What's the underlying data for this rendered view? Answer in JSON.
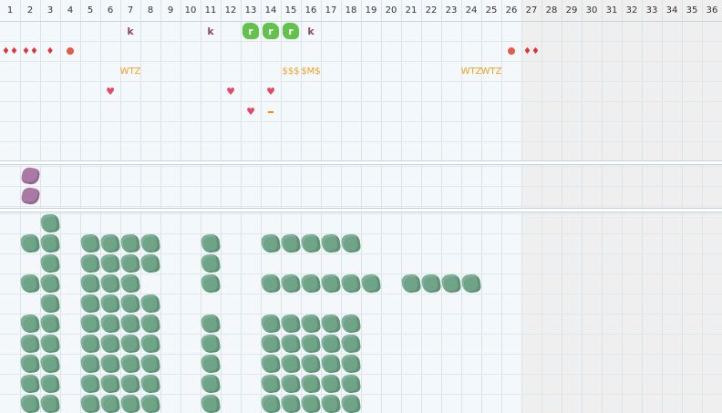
{
  "columns": [
    "1",
    "2",
    "3",
    "4",
    "5",
    "6",
    "7",
    "8",
    "9",
    "10",
    "11",
    "12",
    "13",
    "14",
    "15",
    "16",
    "17",
    "18",
    "19",
    "20",
    "21",
    "22",
    "23",
    "24",
    "25",
    "26",
    "27",
    "28",
    "29",
    "30",
    "31",
    "32",
    "33",
    "34",
    "35",
    "36"
  ],
  "colors": {
    "leaf": "#6fa489",
    "purple": "#a97aa3",
    "badge": "#63c24b",
    "heart": "#e04a66",
    "drop": "#e0333a",
    "orange": "#f0a020",
    "shade": "#efefef"
  },
  "section1": {
    "k_markers": [
      {
        "col": 7,
        "text": "k"
      },
      {
        "col": 11,
        "text": "k"
      },
      {
        "col": 16,
        "text": "k"
      }
    ],
    "badges": [
      {
        "col": 13,
        "text": "r"
      },
      {
        "col": 14,
        "text": "r"
      },
      {
        "col": 15,
        "text": "r"
      }
    ],
    "drops": [
      {
        "col": 1,
        "text": "♦♦"
      },
      {
        "col": 2,
        "text": "♦♦"
      },
      {
        "col": 3,
        "text": "♦"
      },
      {
        "col": 27,
        "text": "♦♦"
      }
    ],
    "dots": [
      4,
      26
    ],
    "labels": [
      {
        "col": 7,
        "text": "WTZ"
      },
      {
        "col": 15,
        "text": "$$$"
      },
      {
        "col": 16,
        "text": "$M$"
      },
      {
        "col": 24,
        "text": "WTZ"
      },
      {
        "col": 25,
        "text": "WTZ"
      }
    ],
    "hearts": [
      {
        "col": 6,
        "row": 3
      },
      {
        "col": 12,
        "row": 3
      },
      {
        "col": 14,
        "row": 3
      },
      {
        "col": 13,
        "row": 4
      }
    ],
    "dash_col": 14
  },
  "section2": {
    "purple_rows": [
      [
        2
      ],
      [
        2
      ]
    ]
  },
  "section3": {
    "leaf_rows": [
      [
        3
      ],
      [
        2,
        3,
        5,
        6,
        7,
        8,
        11,
        14,
        15,
        16,
        17,
        18
      ],
      [
        3,
        5,
        6,
        7,
        8,
        11
      ],
      [
        2,
        3,
        5,
        6,
        7,
        11,
        14,
        15,
        16,
        17,
        18,
        19,
        21,
        22,
        23,
        24
      ],
      [
        3,
        5,
        6,
        7,
        8
      ],
      [
        2,
        3,
        5,
        6,
        7,
        8,
        11,
        14,
        15,
        16,
        17,
        18
      ],
      [
        2,
        3,
        5,
        6,
        7,
        8,
        11,
        14,
        15,
        16,
        17,
        18
      ],
      [
        2,
        3,
        5,
        6,
        7,
        8,
        11,
        14,
        15,
        16,
        17,
        18
      ],
      [
        2,
        3,
        5,
        6,
        7,
        8,
        11,
        14,
        15,
        16,
        17,
        18
      ],
      [
        2,
        3,
        5,
        6,
        7,
        8,
        11,
        14,
        15,
        16,
        17,
        18
      ]
    ]
  }
}
